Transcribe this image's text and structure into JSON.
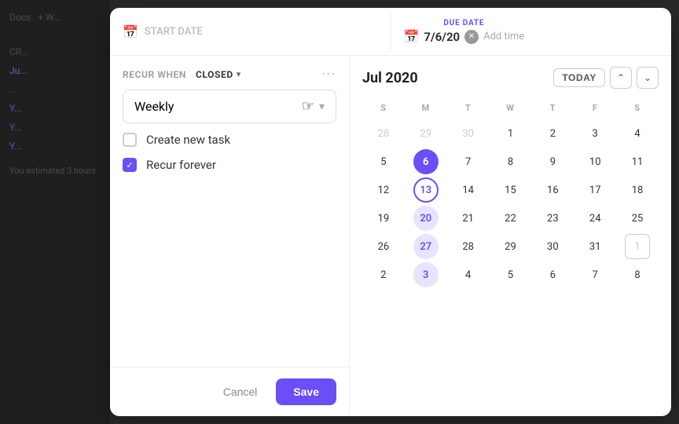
{
  "background": {
    "sidebar_items": [
      {
        "label": "Docs",
        "active": false
      },
      {
        "label": "+ W...",
        "active": false
      }
    ],
    "content_items": [
      {
        "prefix": "CR...",
        "text": ""
      },
      {
        "prefix": "Ju...",
        "text": ""
      },
      {
        "prefix": "...",
        "text": ""
      },
      {
        "prefix": "Y...",
        "text": ""
      },
      {
        "prefix": "Y...",
        "text": ""
      },
      {
        "prefix": "Y...",
        "text": ""
      },
      {
        "prefix": "You estimated 3 hours",
        "text": ""
      }
    ]
  },
  "header": {
    "due_date_label": "DUE DATE",
    "start_date_placeholder": "START DATE",
    "due_date_value": "7/6/20",
    "add_time_label": "Add time"
  },
  "recur": {
    "text": "RECUR WHEN",
    "closed": "CLOSED",
    "frequency": "Weekly",
    "options": [
      {
        "id": "create_new_task",
        "label": "Create new task",
        "checked": false
      },
      {
        "id": "recur_forever",
        "label": "Recur forever",
        "checked": true
      }
    ],
    "dots_label": "···"
  },
  "calendar": {
    "month_label": "Jul 2020",
    "today_button": "TODAY",
    "day_headers": [
      "S",
      "M",
      "T",
      "W",
      "T",
      "F",
      "S"
    ],
    "weeks": [
      [
        {
          "day": "28",
          "muted": true
        },
        {
          "day": "29",
          "muted": true
        },
        {
          "day": "30",
          "muted": true
        },
        {
          "day": "1"
        },
        {
          "day": "2"
        },
        {
          "day": "3"
        },
        {
          "day": "4"
        }
      ],
      [
        {
          "day": "5"
        },
        {
          "day": "6",
          "today": true
        },
        {
          "day": "7"
        },
        {
          "day": "8"
        },
        {
          "day": "9"
        },
        {
          "day": "10"
        },
        {
          "day": "11"
        }
      ],
      [
        {
          "day": "12"
        },
        {
          "day": "13",
          "selected_ring": true
        },
        {
          "day": "14"
        },
        {
          "day": "15"
        },
        {
          "day": "16"
        },
        {
          "day": "17"
        },
        {
          "day": "18"
        }
      ],
      [
        {
          "day": "19"
        },
        {
          "day": "20",
          "light_circle": true
        },
        {
          "day": "21"
        },
        {
          "day": "22"
        },
        {
          "day": "23"
        },
        {
          "day": "24"
        },
        {
          "day": "25"
        }
      ],
      [
        {
          "day": "26"
        },
        {
          "day": "27",
          "light_circle": true
        },
        {
          "day": "28"
        },
        {
          "day": "29"
        },
        {
          "day": "30"
        },
        {
          "day": "31"
        },
        {
          "day": "1",
          "highlight_box": true
        }
      ],
      [
        {
          "day": "2"
        },
        {
          "day": "3",
          "light_circle": true
        },
        {
          "day": "4"
        },
        {
          "day": "5"
        },
        {
          "day": "6"
        },
        {
          "day": "7"
        },
        {
          "day": "8"
        }
      ]
    ]
  },
  "footer": {
    "cancel_label": "Cancel",
    "save_label": "Save"
  }
}
